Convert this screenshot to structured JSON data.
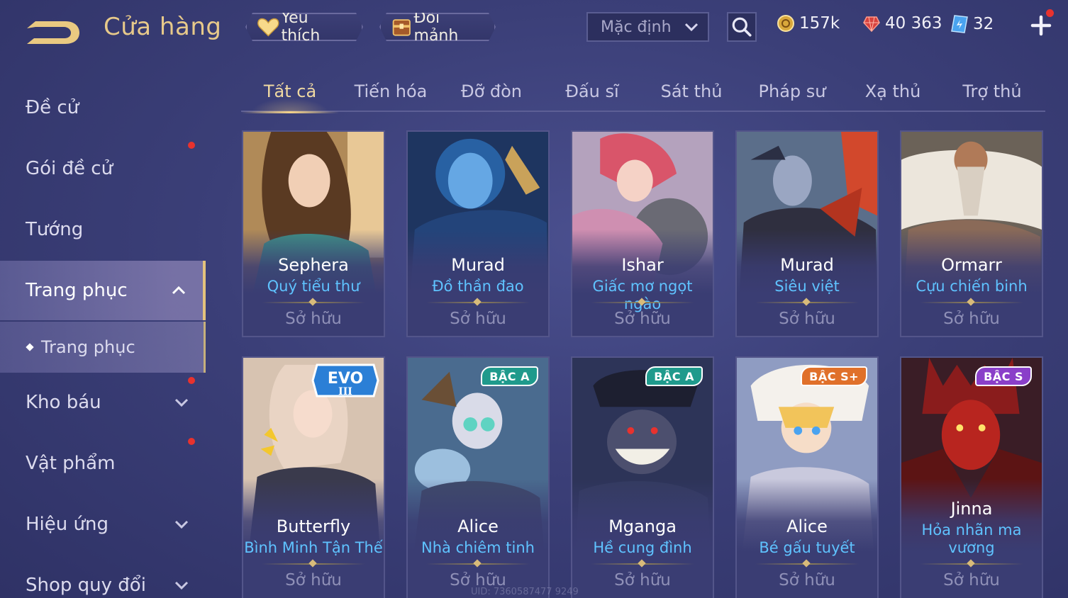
{
  "header": {
    "title": "Cửa hàng",
    "favorites_label": "Yêu thích",
    "shard_exchange_label": "Đổi mảnh",
    "sort": {
      "selected": "Mặc định"
    },
    "currencies": {
      "gold": "157k",
      "ruby": "40 363",
      "voucher": "32"
    }
  },
  "sidebar": {
    "items": [
      {
        "label": "Đề cử"
      },
      {
        "label": "Gói đề cử"
      },
      {
        "label": "Tướng"
      },
      {
        "label": "Trang phục"
      },
      {
        "label": "Trang phục"
      },
      {
        "label": "Kho báu"
      },
      {
        "label": "Vật phẩm"
      },
      {
        "label": "Hiệu ứng"
      },
      {
        "label": "Shop quy đổi"
      }
    ]
  },
  "tabs": [
    {
      "label": "Tất cả"
    },
    {
      "label": "Tiến hóa"
    },
    {
      "label": "Đỡ đòn"
    },
    {
      "label": "Đấu sĩ"
    },
    {
      "label": "Sát thủ"
    },
    {
      "label": "Pháp sư"
    },
    {
      "label": "Xạ thủ"
    },
    {
      "label": "Trợ thủ"
    }
  ],
  "skins": [
    {
      "hero": "Sephera",
      "name": "Quý tiểu thư",
      "status": "Sở hữu"
    },
    {
      "hero": "Murad",
      "name": "Đồ thần đao",
      "status": "Sở hữu"
    },
    {
      "hero": "Ishar",
      "name": "Giấc mơ ngọt ngào",
      "status": "Sở hữu"
    },
    {
      "hero": "Murad",
      "name": "Siêu việt",
      "status": "Sở hữu"
    },
    {
      "hero": "Ormarr",
      "name": "Cựu chiến binh",
      "status": "Sở hữu"
    },
    {
      "hero": "Butterfly",
      "name": "Bình Minh Tận Thế",
      "status": "Sở hữu",
      "badge": "EVO",
      "badge_sub": "III"
    },
    {
      "hero": "Alice",
      "name": "Nhà chiêm tinh",
      "status": "Sở hữu",
      "badge": "BẬC A"
    },
    {
      "hero": "Mganga",
      "name": "Hề cung đình",
      "status": "Sở hữu",
      "badge": "BẬC A"
    },
    {
      "hero": "Alice",
      "name": "Bé gấu tuyết",
      "status": "Sở hữu",
      "badge": "BẬC S+"
    },
    {
      "hero": "Jinna",
      "name": "Hỏa nhãn ma vương",
      "status": "Sở hữu",
      "badge": "BẬC S"
    }
  ],
  "footer": {
    "uid": "UID: 7360587477 9249"
  },
  "colors": {
    "accent_gold": "#e7c98a",
    "skin_name": "#5fc3ff",
    "notify_dot": "#e8322e",
    "badge_a": "#1f9a8c",
    "badge_s_plus": "#e0702a",
    "badge_s": "#8a3fc9"
  }
}
